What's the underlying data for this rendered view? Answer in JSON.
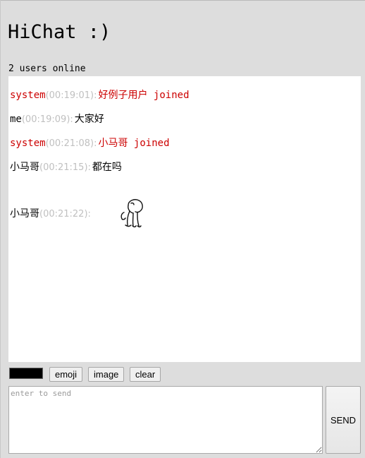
{
  "app": {
    "title": "HiChat :)",
    "status": "2 users online"
  },
  "messages": [
    {
      "sender": "system",
      "time": "(00:19:01):",
      "body": "好例子用户 joined",
      "kind": "system"
    },
    {
      "sender": "me",
      "time": "(00:19:09):",
      "body": "大家好",
      "kind": "user"
    },
    {
      "sender": "system",
      "time": "(00:21:08):",
      "body": "小马哥 joined",
      "kind": "system"
    },
    {
      "sender": "小马哥",
      "time": "(00:21:15):",
      "body": "都在吗",
      "kind": "user"
    },
    {
      "sender": "小马哥",
      "time": "(00:21:22):",
      "body": "",
      "kind": "image",
      "image_icon": "cartoon-sticker-icon"
    }
  ],
  "toolbar": {
    "color_value": "#000000",
    "emoji_label": "emoji",
    "image_label": "image",
    "clear_label": "clear"
  },
  "input": {
    "placeholder": "enter to send",
    "value": ""
  },
  "send_label": "SEND",
  "colors": {
    "page_bg": "#dddddd",
    "system_text": "#cc0000",
    "timestamp": "#c0c0c0",
    "panel_bg": "#ffffff"
  }
}
